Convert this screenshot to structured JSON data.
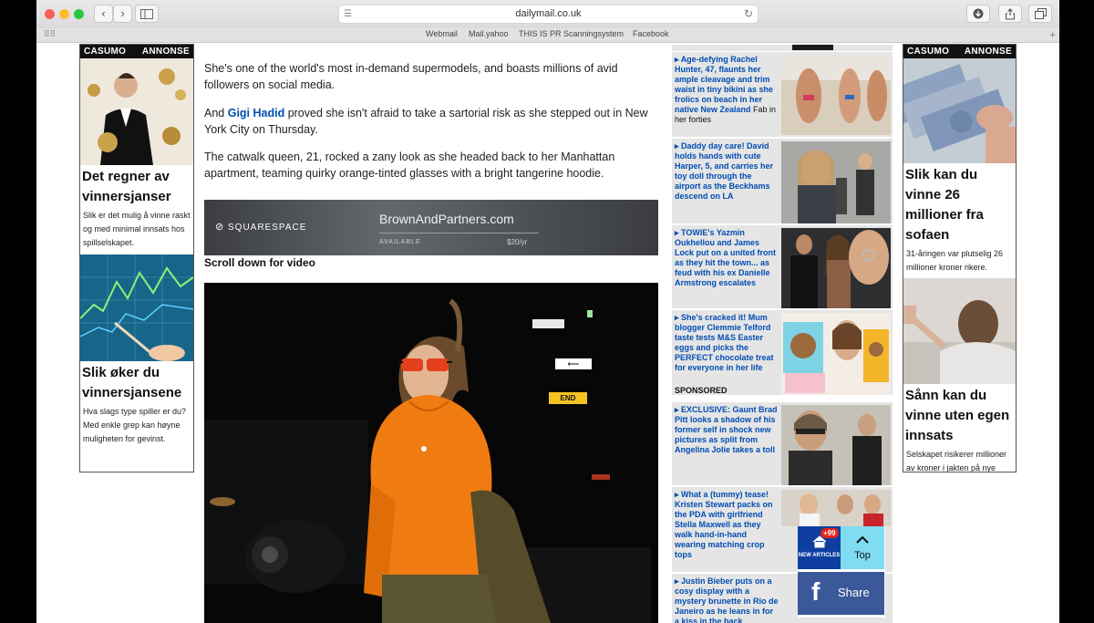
{
  "browser": {
    "url": "dailymail.co.uk",
    "favorites": [
      "Webmail",
      "Mail.yahoo",
      "THIS IS PR Scanningsystem",
      "Facebook"
    ]
  },
  "left_ad": {
    "brand": "CASUMO",
    "tag": "ANNONSE",
    "item1": {
      "title": "Det regner av vinnersjanser",
      "desc": "Slik er det mulig å vinne raskt og med minimal innsats hos spillselskapet."
    },
    "item2": {
      "title": "Slik øker du vinnersjansene",
      "desc": "Hva slags type spiller er du? Med enkle grep kan høyne muligheten for gevinst."
    }
  },
  "right_ad": {
    "brand": "CASUMO",
    "tag": "ANNONSE",
    "item1": {
      "title": "Slik kan du vinne 26 millioner fra sofaen",
      "desc": "31-åringen var plutselig 26 millioner kroner rikere."
    },
    "item2": {
      "title": "Sånn kan du vinne uten egen innsats",
      "desc": "Selskapet risikerer millioner av kroner i jakten på nye millionærer."
    }
  },
  "article": {
    "p1": "She's one of the world's most in-demand supermodels, and boasts millions of avid followers on social media.",
    "p2_pre": "And ",
    "p2_link": "Gigi Hadid",
    "p2_post": " proved she isn't afraid to take a sartorial risk as she stepped out in New York City on Thursday.",
    "p3": "The catwalk queen, 21, rocked a zany look as she headed back to her Manhattan apartment, teaming quirky orange-tinted glasses with a bright tangerine hoodie.",
    "scroll_label": "Scroll down for video"
  },
  "squarespace_ad": {
    "logo": "SQUARESPACE",
    "domain": "BrownAndPartners.com",
    "status": "AVAILABLE",
    "price": "$20/yr"
  },
  "street_signs": {
    "arrow": "⟵",
    "end": "END"
  },
  "sidebar": [
    {
      "headline": "Age-defying Rachel Hunter, 47, flaunts her ample cleavage and trim waist in tiny bikini as she frolics on beach in her native New Zealand",
      "extra": "Fab in her forties"
    },
    {
      "headline": "Daddy day care! David holds hands with cute Harper, 5, and carries her toy doll through the airport as the Beckhams descend on LA",
      "extra": ""
    },
    {
      "headline": "TOWIE's Yazmin Oukhellou and James Lock put on a united front as they hit the town... as feud with his ex Danielle Armstrong escalates",
      "extra": ""
    },
    {
      "headline": "She's cracked it! Mum blogger Clemmie Telford taste tests M&S Easter eggs and picks the PERFECT chocolate treat for everyone in her life",
      "extra": ""
    },
    {
      "headline": "EXCLUSIVE: Gaunt Brad Pitt looks a shadow of his former self in shock new pictures as split from Angelina Jolie takes a toll",
      "extra": ""
    },
    {
      "headline": "What a (tummy) tease! Kristen Stewart packs on the PDA with girlfriend Stella Maxwell as they walk hand-in-hand wearing matching crop tops",
      "extra": ""
    },
    {
      "headline": "Justin Bieber puts on a cosy display with a mystery brunette in Rio de Janeiro as he leans in for a kiss in the back",
      "extra": ""
    }
  ],
  "sponsored_label": "SPONSORED",
  "floating": {
    "badge": "+99",
    "new_articles": "NEW ARTICLES",
    "top": "Top",
    "share": "Share"
  }
}
